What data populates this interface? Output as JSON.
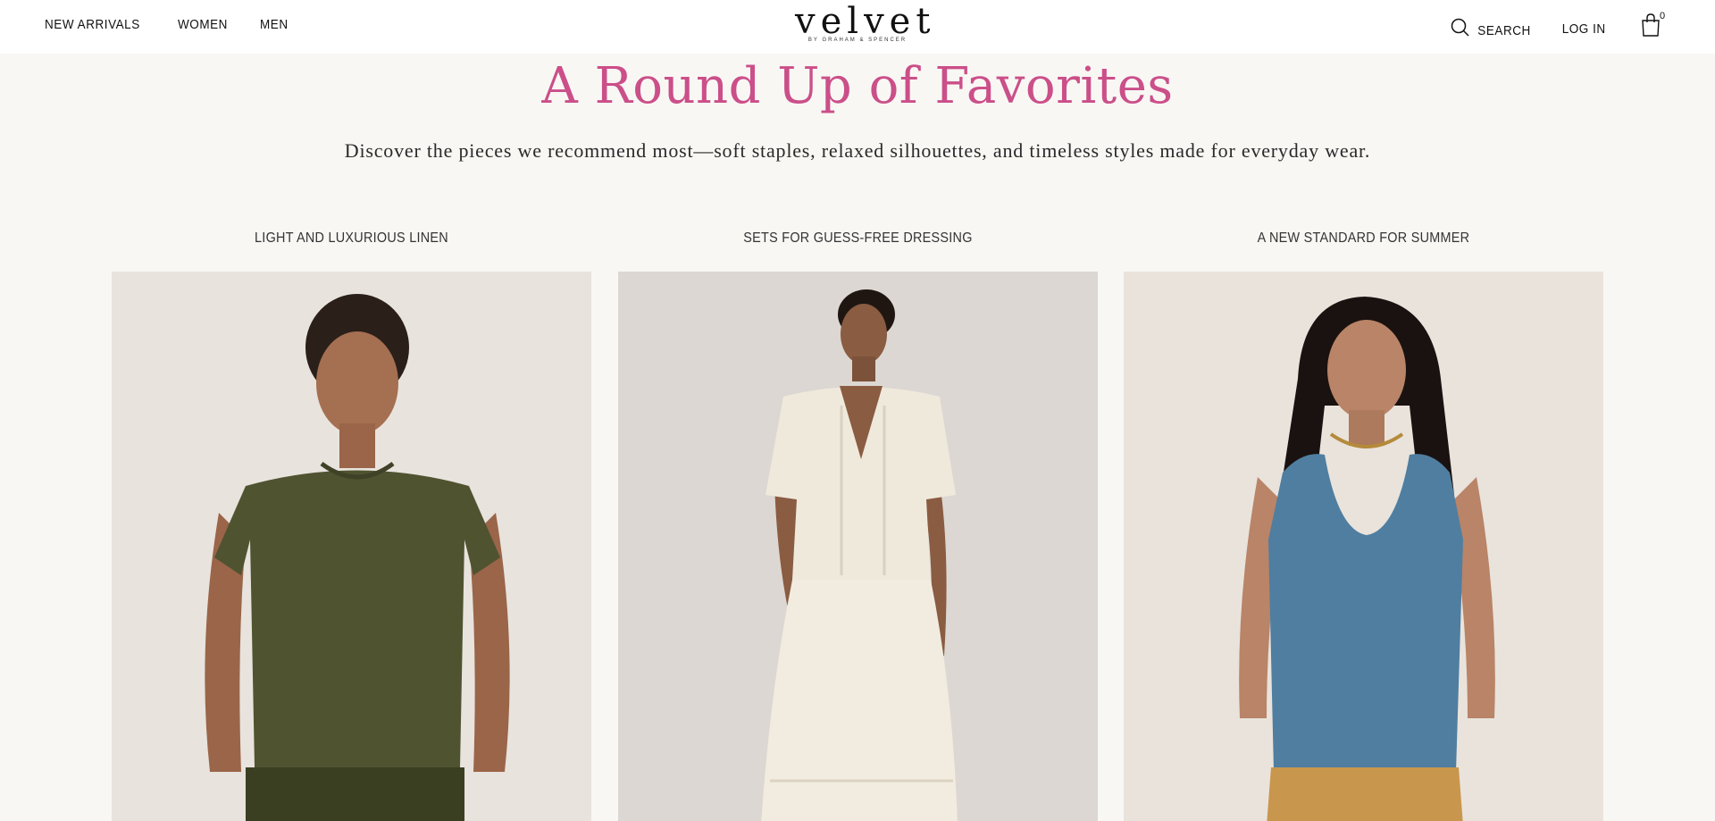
{
  "header": {
    "nav_left": [
      "NEW ARRIVALS",
      "WOMEN",
      "MEN"
    ],
    "logo": {
      "main": "velvet",
      "sub": "BY GRAHAM & SPENCER"
    },
    "search_label": "SEARCH",
    "login_label": "LOG IN",
    "cart_count": "0"
  },
  "hero": {
    "title": "A Round Up of Favorites",
    "subtitle": "Discover the pieces we recommend most—soft staples, relaxed silhouettes, and timeless styles made for everyday wear."
  },
  "cards": [
    {
      "title": "LIGHT AND LUXURIOUS LINEN",
      "image": "model-olive-linen-tee",
      "bg": "#e8e3dd",
      "garment": "#4f5330"
    },
    {
      "title": "SETS FOR GUESS-FREE DRESSING",
      "image": "model-cream-gauze-set",
      "bg": "#dcd7d2",
      "garment": "#efe9dc"
    },
    {
      "title": "A NEW STANDARD FOR SUMMER",
      "image": "model-blue-tank",
      "bg": "#e9e3dc",
      "garment": "#4f7ea0"
    }
  ],
  "colors": {
    "accent": "#cb4f89",
    "background": "#f8f7f4",
    "header_bg": "#ffffff"
  }
}
